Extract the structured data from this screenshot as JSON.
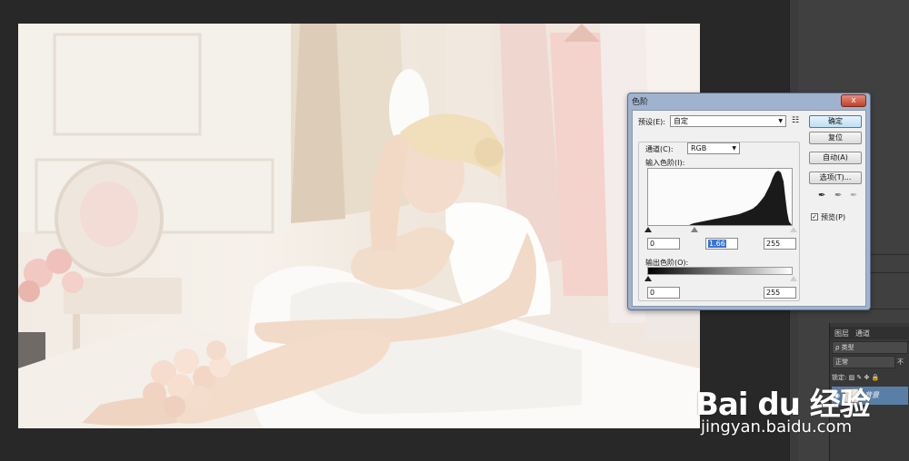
{
  "dialog": {
    "title": "色阶",
    "close_glyph": "x",
    "preset_label": "预设(E):",
    "preset_value": "自定",
    "channel_label": "通道(C):",
    "channel_value": "RGB",
    "input_levels_label": "输入色阶(I):",
    "input_black": "0",
    "input_gamma": "1.66",
    "input_white": "255",
    "output_levels_label": "输出色阶(O):",
    "output_black": "0",
    "output_white": "255",
    "buttons": {
      "ok": "确定",
      "reset": "复位",
      "auto": "自动(A)",
      "options": "选项(T)..."
    },
    "preview_label": "预览(P)",
    "preview_checked": true,
    "icons": [
      "preset-options-icon",
      "black-eyedropper-icon",
      "gray-eyedropper-icon",
      "white-eyedropper-icon"
    ]
  },
  "layers_panel": {
    "tabs": [
      "图层",
      "通道"
    ],
    "filter": "ρ 类型",
    "blend_mode": "正常",
    "opacity_prefix": "不",
    "lock_label": "锁定:",
    "layer_name": "背景"
  },
  "watermark": {
    "brand": "Bai du 经验",
    "url": "jingyan.baidu.com"
  },
  "colors": {
    "dialog_frame": "#9fb3cf",
    "dialog_body": "#f0f0f0",
    "workspace": "#282828",
    "selected_layer": "#5a7fa6",
    "close_button": "#c2412b"
  }
}
